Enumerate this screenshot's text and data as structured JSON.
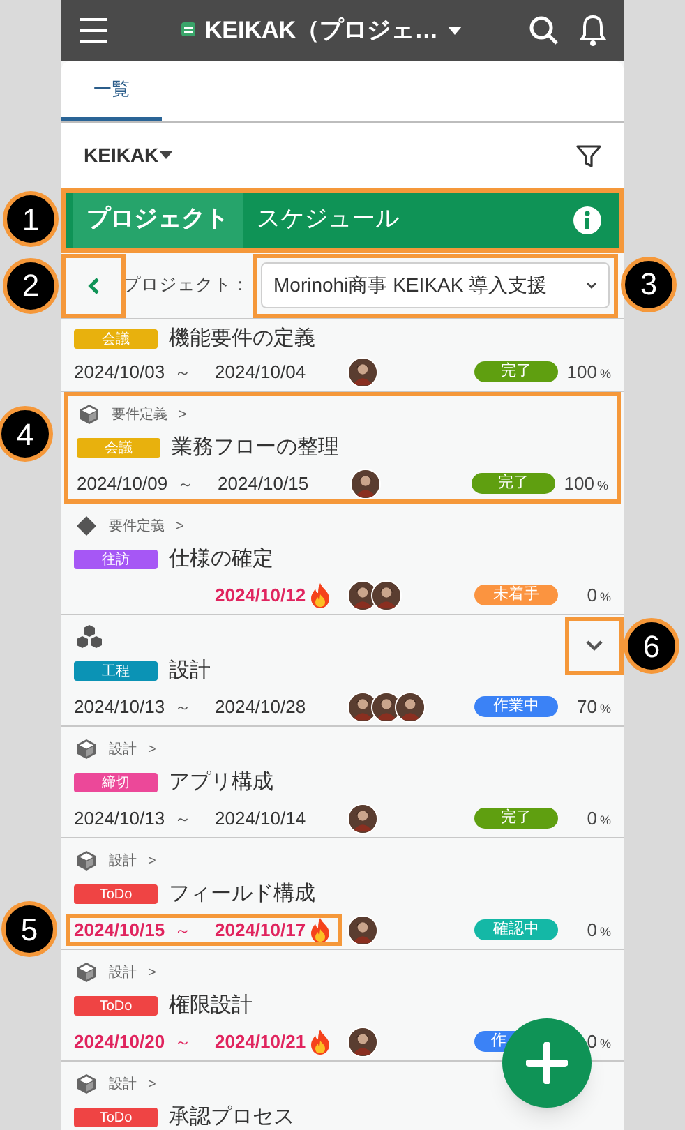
{
  "header": {
    "title": "KEIKAK（プロジェ…"
  },
  "tabs": [
    {
      "label": "一覧",
      "selected": true
    }
  ],
  "workspace": {
    "label": "KEIKAK"
  },
  "view_tabs": {
    "callout": "1",
    "tabs": [
      {
        "label": "プロジェクト",
        "selected": true
      },
      {
        "label": "スケジュール",
        "selected": false
      }
    ]
  },
  "project_filter": {
    "back_callout": "2",
    "label": "プロジェクト：",
    "select_callout": "3",
    "value": "Morinohi商事 KEIKAK 導入支援"
  },
  "tasks": [
    {
      "kind": "plain",
      "tag": {
        "label": "会議",
        "color": "#e8b10d"
      },
      "title": "機能要件の定義",
      "start": "2024/10/03",
      "separator": "～",
      "end": "2024/10/04",
      "overdue": false,
      "status": {
        "label": "完了",
        "color": "#5f9f10"
      },
      "progress": "100",
      "unit": "%"
    },
    {
      "kind": "subtask",
      "breadcrumb": "要件定義",
      "arrow": ">",
      "callout": "4",
      "tag": {
        "label": "会議",
        "color": "#e8b10d"
      },
      "title": "業務フローの整理",
      "start": "2024/10/09",
      "separator": "～",
      "end": "2024/10/15",
      "overdue": false,
      "status": {
        "label": "完了",
        "color": "#5f9f10"
      },
      "progress": "100",
      "unit": "%"
    },
    {
      "kind": "milestone",
      "breadcrumb": "要件定義",
      "arrow": ">",
      "tag": {
        "label": "往訪",
        "color": "#a657f5"
      },
      "title": "仕様の確定",
      "end": "2024/10/12",
      "overdue": true,
      "status": {
        "label": "未着手",
        "color": "#fb9440"
      },
      "progress": "0",
      "unit": "%"
    },
    {
      "kind": "phase",
      "expand_callout": "6",
      "expanded": false,
      "tag": {
        "label": "工程",
        "color": "#0b93b5"
      },
      "title": "設計",
      "start": "2024/10/13",
      "separator": "～",
      "end": "2024/10/28",
      "overdue": false,
      "status": {
        "label": "作業中",
        "color": "#3b82f6"
      },
      "progress": "70",
      "unit": "%"
    },
    {
      "kind": "subtask",
      "breadcrumb": "設計",
      "arrow": ">",
      "tag": {
        "label": "締切",
        "color": "#ec4899"
      },
      "title": "アプリ構成",
      "start": "2024/10/13",
      "separator": "～",
      "end": "2024/10/14",
      "overdue": false,
      "status": {
        "label": "完了",
        "color": "#5f9f10"
      },
      "progress": "0",
      "unit": "%"
    },
    {
      "kind": "subtask",
      "breadcrumb": "設計",
      "arrow": ">",
      "tag": {
        "label": "ToDo",
        "color": "#ef4444"
      },
      "title": "フィールド構成",
      "start": "2024/10/15",
      "separator": "～",
      "end": "2024/10/17",
      "overdue": true,
      "date_callout": "5",
      "status": {
        "label": "確認中",
        "color": "#14b8a6"
      },
      "progress": "0",
      "unit": "%"
    },
    {
      "kind": "subtask",
      "breadcrumb": "設計",
      "arrow": ">",
      "tag": {
        "label": "ToDo",
        "color": "#ef4444"
      },
      "title": "権限設計",
      "start": "2024/10/20",
      "separator": "～",
      "end": "2024/10/21",
      "overdue": true,
      "status": {
        "label": "作",
        "color": "#3b82f6"
      },
      "progress": "0",
      "unit": "%"
    },
    {
      "kind": "subtask",
      "breadcrumb": "設計",
      "arrow": ">",
      "tag": {
        "label": "ToDo",
        "color": "#ef4444"
      },
      "title": "承認プロセス"
    }
  ]
}
